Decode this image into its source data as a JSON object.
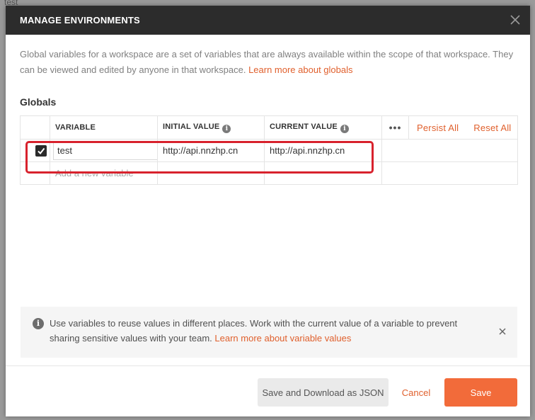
{
  "background": {
    "ghost_text": "test"
  },
  "modal": {
    "title": "MANAGE ENVIRONMENTS",
    "close_icon": "close-icon"
  },
  "intro": {
    "text": "Global variables for a workspace are a set of variables that are always available within the scope of that workspace. They can be viewed and edited by anyone in that workspace.",
    "link": "Learn more about globals"
  },
  "globals": {
    "title": "Globals",
    "columns": {
      "variable": "VARIABLE",
      "initial_value": "INITIAL VALUE",
      "current_value": "CURRENT VALUE",
      "more": "•••",
      "persist_all": "Persist All",
      "reset_all": "Reset All"
    },
    "rows": [
      {
        "enabled": true,
        "variable": "test",
        "initial_value": "http://api.nnzhp.cn",
        "current_value": "http://api.nnzhp.cn"
      }
    ],
    "new_variable_placeholder": "Add a new variable"
  },
  "notice": {
    "text": "Use variables to reuse values in different places. Work with the current value of a variable to prevent sharing sensitive values with your team.",
    "link": "Learn more about variable values"
  },
  "footer": {
    "save_json": "Save and Download as JSON",
    "cancel": "Cancel",
    "save": "Save"
  },
  "colors": {
    "accent": "#e0602d",
    "save_button": "#f26b3a",
    "header_bg": "#2c2c2c",
    "highlight": "#d8222d"
  }
}
